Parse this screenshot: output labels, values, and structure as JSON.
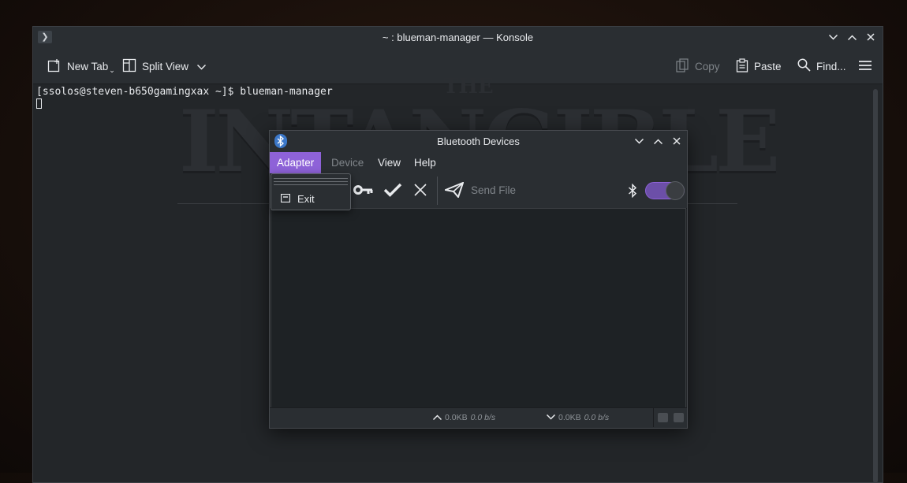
{
  "konsole": {
    "title": "~ : blueman-manager — Konsole",
    "toolbar": {
      "new_tab": "New Tab",
      "split_view": "Split View",
      "copy": "Copy",
      "paste": "Paste",
      "find": "Find..."
    },
    "terminal": {
      "line1": "[ssolos@steven-b650gamingxax ~]$ blueman-manager"
    },
    "background_art": {
      "big_text": "INTANGIBLE",
      "small_text": "THE"
    }
  },
  "bluetooth": {
    "title": "Bluetooth Devices",
    "menu": {
      "adapter": "Adapter",
      "device": "Device",
      "view": "View",
      "help": "Help"
    },
    "toolbar": {
      "send_file": "Send File",
      "power_on": true
    },
    "dropdown": {
      "exit": "Exit"
    },
    "status": {
      "up_amount": "0.0KB",
      "up_rate": "0.0 b/s",
      "down_amount": "0.0KB",
      "down_rate": "0.0 b/s"
    }
  },
  "colors": {
    "accent": "#8e62d8",
    "window_bg": "#232629",
    "titlebar_bg": "#2a2e32",
    "text": "#e8eaed"
  }
}
